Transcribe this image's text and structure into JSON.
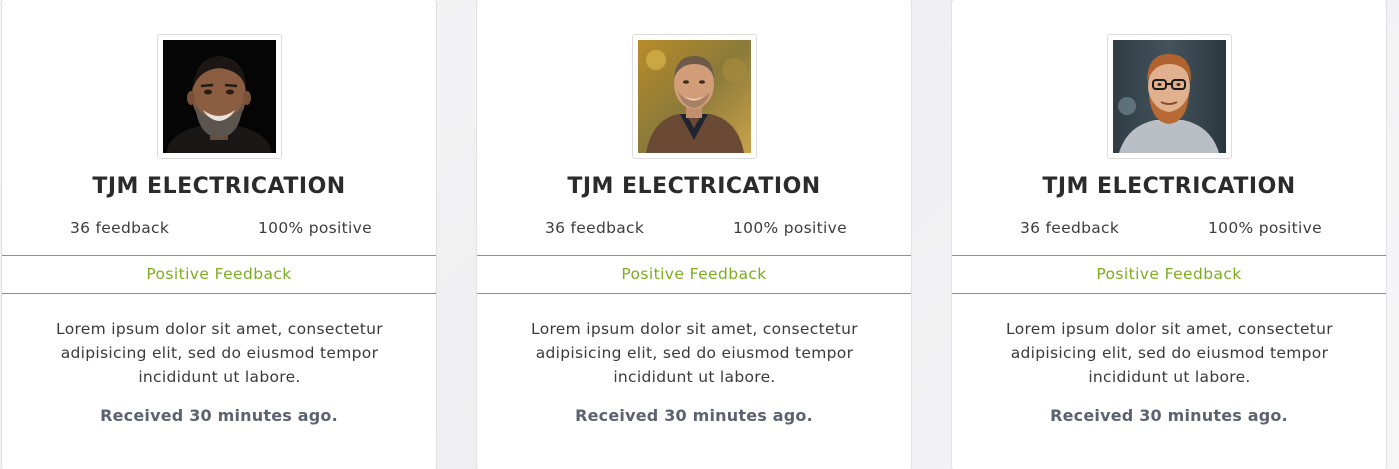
{
  "cards": [
    {
      "name": "TJM ELECTRICATION",
      "feedback_count": "36 feedback",
      "positive_rate": "100% positive",
      "band_label": "Positive Feedback",
      "description": "Lorem ipsum dolor sit amet, consectetur adipisicing elit, sed do eiusmod tempor incididunt ut labore.",
      "received": "Received 30 minutes ago."
    },
    {
      "name": "TJM ELECTRICATION",
      "feedback_count": "36 feedback",
      "positive_rate": "100% positive",
      "band_label": "Positive Feedback",
      "description": "Lorem ipsum dolor sit amet, consectetur adipisicing elit, sed do eiusmod tempor incididunt ut labore.",
      "received": "Received 30 minutes ago."
    },
    {
      "name": "TJM ELECTRICATION",
      "feedback_count": "36 feedback",
      "positive_rate": "100% positive",
      "band_label": "Positive Feedback",
      "description": "Lorem ipsum dolor sit amet, consectetur adipisicing elit, sed do eiusmod tempor incididunt ut labore.",
      "received": "Received 30 minutes ago."
    }
  ],
  "colors": {
    "accent": "#7cae1e",
    "name_text": "#2b2b2b",
    "received_text": "#5b6270",
    "card_border": "#e2e2e2"
  },
  "icons": [
    "avatar-photo"
  ]
}
